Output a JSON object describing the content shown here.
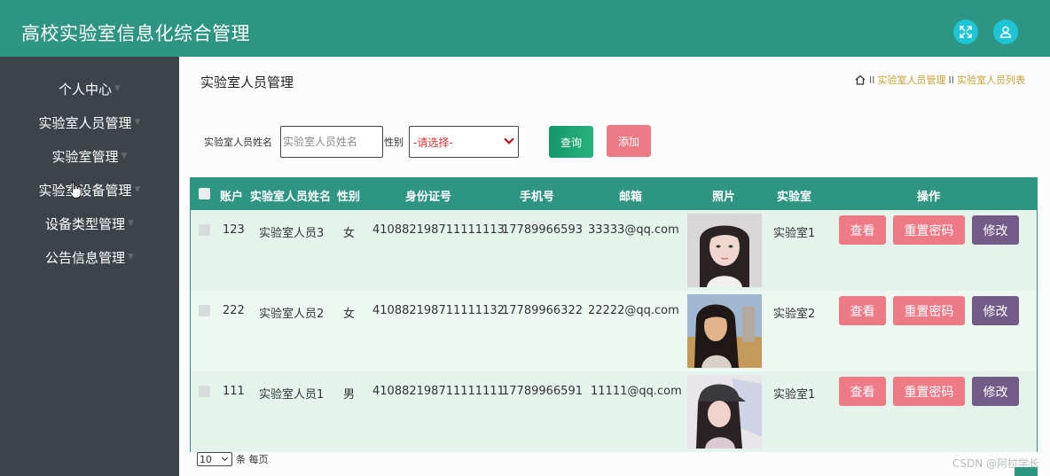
{
  "header": {
    "title": "高校实验室信息化综合管理",
    "accent_color": "#2f9583"
  },
  "sidebar": {
    "items": [
      {
        "label": "个人中心"
      },
      {
        "label": "实验室人员管理"
      },
      {
        "label": "实验室管理"
      },
      {
        "label": "实验室设备管理"
      },
      {
        "label": "设备类型管理"
      },
      {
        "label": "公告信息管理"
      }
    ]
  },
  "main": {
    "page_title": "实验室人员管理",
    "breadcrumb": [
      "实验室人员管理",
      "实验室人员列表"
    ],
    "search": {
      "name_label": "实验室人员姓名",
      "name_placeholder": "实验室人员姓名",
      "gender_label": "性别",
      "gender_selected": "-请选择-",
      "query_button": "查询",
      "add_button": "添加"
    },
    "table": {
      "columns": [
        "账户",
        "实验室人员姓名",
        "性别",
        "身份证号",
        "手机号",
        "邮箱",
        "照片",
        "实验室",
        "操作"
      ],
      "rows": [
        {
          "account": "123",
          "name": "实验室人员3",
          "gender": "女",
          "id_number": "410882198711111113",
          "phone": "17789966593",
          "email": "33333@qq.com",
          "lab": "实验室1"
        },
        {
          "account": "222",
          "name": "实验室人员2",
          "gender": "女",
          "id_number": "410882198711111132",
          "phone": "17789966322",
          "email": "22222@qq.com",
          "lab": "实验室2"
        },
        {
          "account": "111",
          "name": "实验室人员1",
          "gender": "男",
          "id_number": "410882198711111111",
          "phone": "17789966591",
          "email": "11111@qq.com",
          "lab": "实验室1"
        }
      ],
      "actions": {
        "view": "查看",
        "reset": "重置密码",
        "edit": "修改"
      }
    },
    "pagination": {
      "page_size": "10",
      "suffix": "条 每页"
    }
  },
  "watermark": "CSDN @阿拉学长"
}
